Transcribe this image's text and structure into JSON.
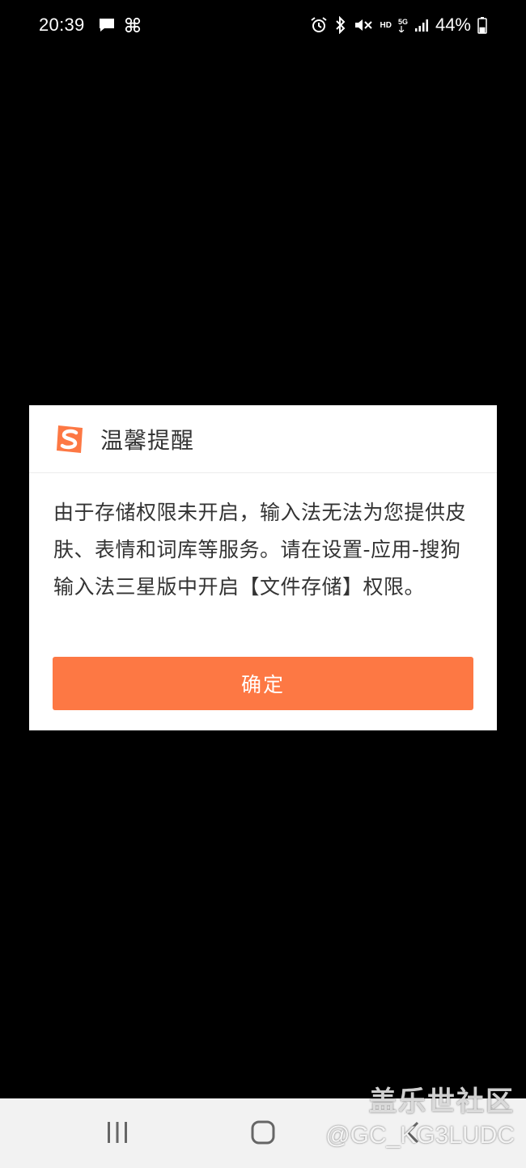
{
  "status_bar": {
    "time": "20:39",
    "left_icons": [
      "message-icon",
      "fan-icon"
    ],
    "right_icons": [
      "alarm-icon",
      "bluetooth-icon",
      "mute-icon",
      "hd-icon",
      "5g-icon",
      "signal-icon",
      "battery-icon"
    ],
    "hd_label": "HD",
    "network_label": "5G",
    "battery_percent": "44%",
    "battery_level": 0.44
  },
  "dialog": {
    "title": "温馨提醒",
    "message": "由于存储权限未开启，输入法无法为您提供皮肤、表情和词库等服务。请在设置-应用-搜狗输入法三星版中开启【文件存储】权限。",
    "ok_button_label": "确定",
    "logo_icon": "sogou-logo-icon",
    "colors": {
      "accent": "#fd7844",
      "text": "#333333",
      "background": "#ffffff"
    }
  },
  "nav_bar": {
    "buttons": [
      "recent-apps-icon",
      "home-icon",
      "back-icon"
    ]
  },
  "watermark": {
    "line1": "盖乐世社区",
    "line2": "@GC_KG3LUDC"
  }
}
